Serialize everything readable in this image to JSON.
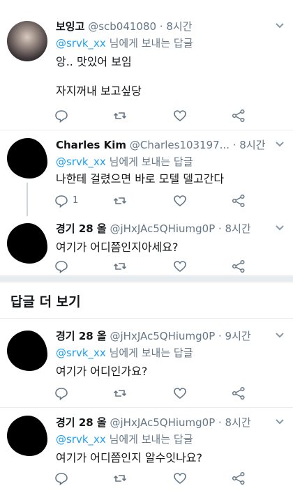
{
  "tweets": [
    {
      "name": "보잉고",
      "handle": "@scb041080 · 8시간",
      "reply_to_mention": "@srvk_xx",
      "reply_to_suffix": " 님에게 보내는 답글",
      "text_line1": "앙.. 맛있어 보임",
      "text_line2": "자지꺼내 보고싶당",
      "reply_count": ""
    },
    {
      "name": "Charles Kim",
      "handle": "@Charles103197... · 8시간",
      "reply_to_mention": "@srvk_xx",
      "reply_to_suffix": " 님에게 보내는 답글",
      "text_line1": "나한테 걸렸으면 바로 모텔 델고간다",
      "reply_count": "1"
    },
    {
      "name": "경기 28 올",
      "handle": "@jHxJAc5QHiumg0P · 8시간",
      "text_line1": "여기가 어디쯤인지아세요?"
    },
    {
      "name": "경기 28 올",
      "handle": "@jHxJAc5QHiumg0P · 9시간",
      "reply_to_mention": "@srvk_xx",
      "reply_to_suffix": " 님에게 보내는 답글",
      "text_line1": "여기가 어디인가요?"
    },
    {
      "name": "경기 28 올",
      "handle": "@jHxJAc5QHiumg0P · 8시간",
      "reply_to_mention": "@srvk_xx",
      "reply_to_suffix": " 님에게 보내는 답글",
      "text_line1": "여기가 어디쯤인지 알수잇나요?"
    }
  ],
  "more_replies_title": "답글 더 보기",
  "icons": [
    "reply-icon",
    "retweet-icon",
    "like-icon",
    "share-icon",
    "chevron-down-icon"
  ],
  "colors": {
    "link": "#1da1f2",
    "secondary": "#657786",
    "divider": "#e6ecf0",
    "icon": "#657786"
  }
}
